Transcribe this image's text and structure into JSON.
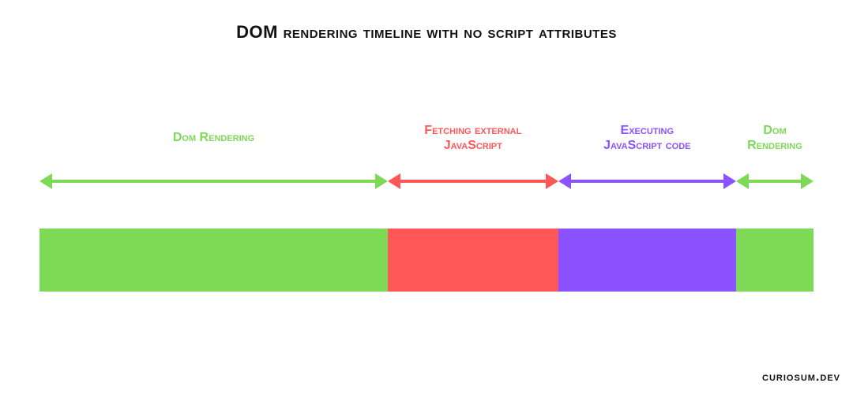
{
  "title": "DOM rendering timeline with no script attributes",
  "attribution": "curiosum.dev",
  "colors": {
    "green": "#7ED957",
    "red": "#FF5757",
    "purple": "#8C52FF"
  },
  "chart_data": {
    "type": "bar",
    "title": "DOM rendering timeline with no script attributes",
    "xlabel": "",
    "ylabel": "",
    "series": [
      {
        "name": "Dom Rendering",
        "value": 45,
        "color": "green"
      },
      {
        "name": "Fetching external\nJavaScript",
        "value": 22,
        "color": "red"
      },
      {
        "name": "Executing\nJavaScript code",
        "value": 23,
        "color": "purple"
      },
      {
        "name": "Dom\nRendering",
        "value": 10,
        "color": "green"
      }
    ]
  }
}
